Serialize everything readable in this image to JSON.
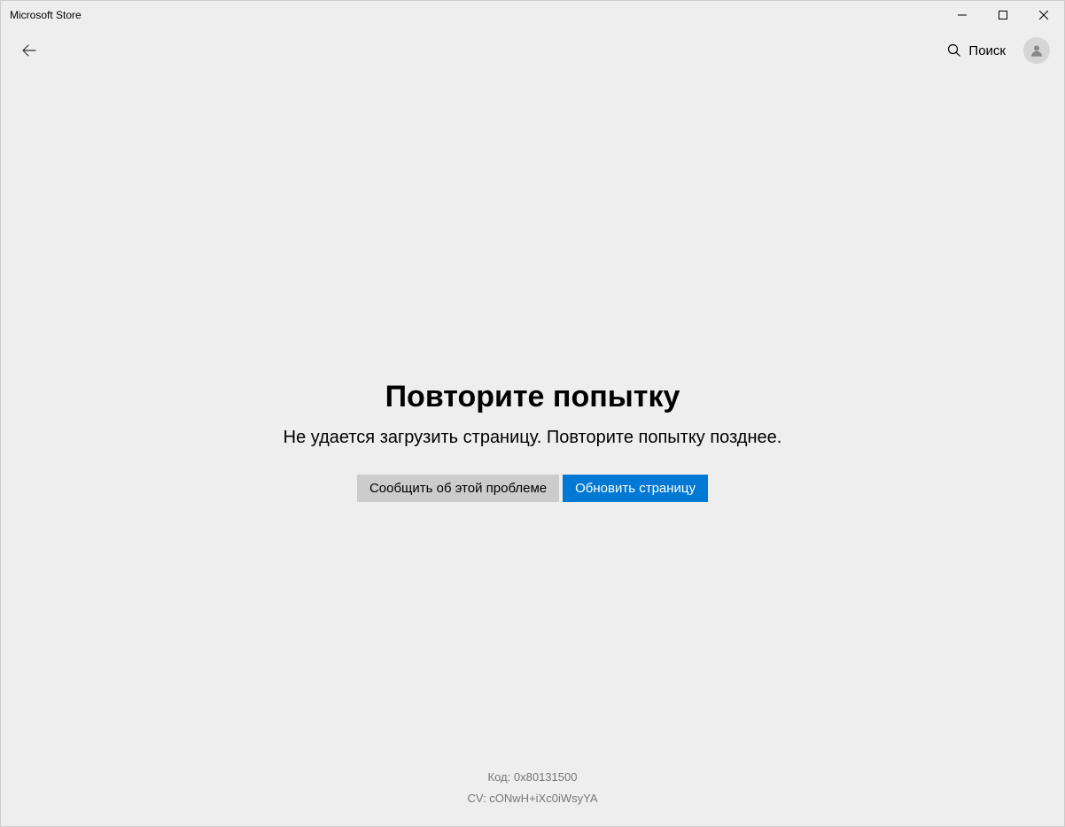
{
  "window": {
    "title": "Microsoft Store"
  },
  "header": {
    "search_label": "Поиск"
  },
  "error": {
    "title": "Повторите попытку",
    "message": "Не удается загрузить страницу. Повторите попытку позднее.",
    "report_button": "Сообщить об этой проблеме",
    "refresh_button": "Обновить страницу"
  },
  "diagnostics": {
    "code_label": "Код",
    "code_value": "0x80131500",
    "cv_label": "CV",
    "cv_value": "cONwH+iXc0iWsyYA"
  }
}
